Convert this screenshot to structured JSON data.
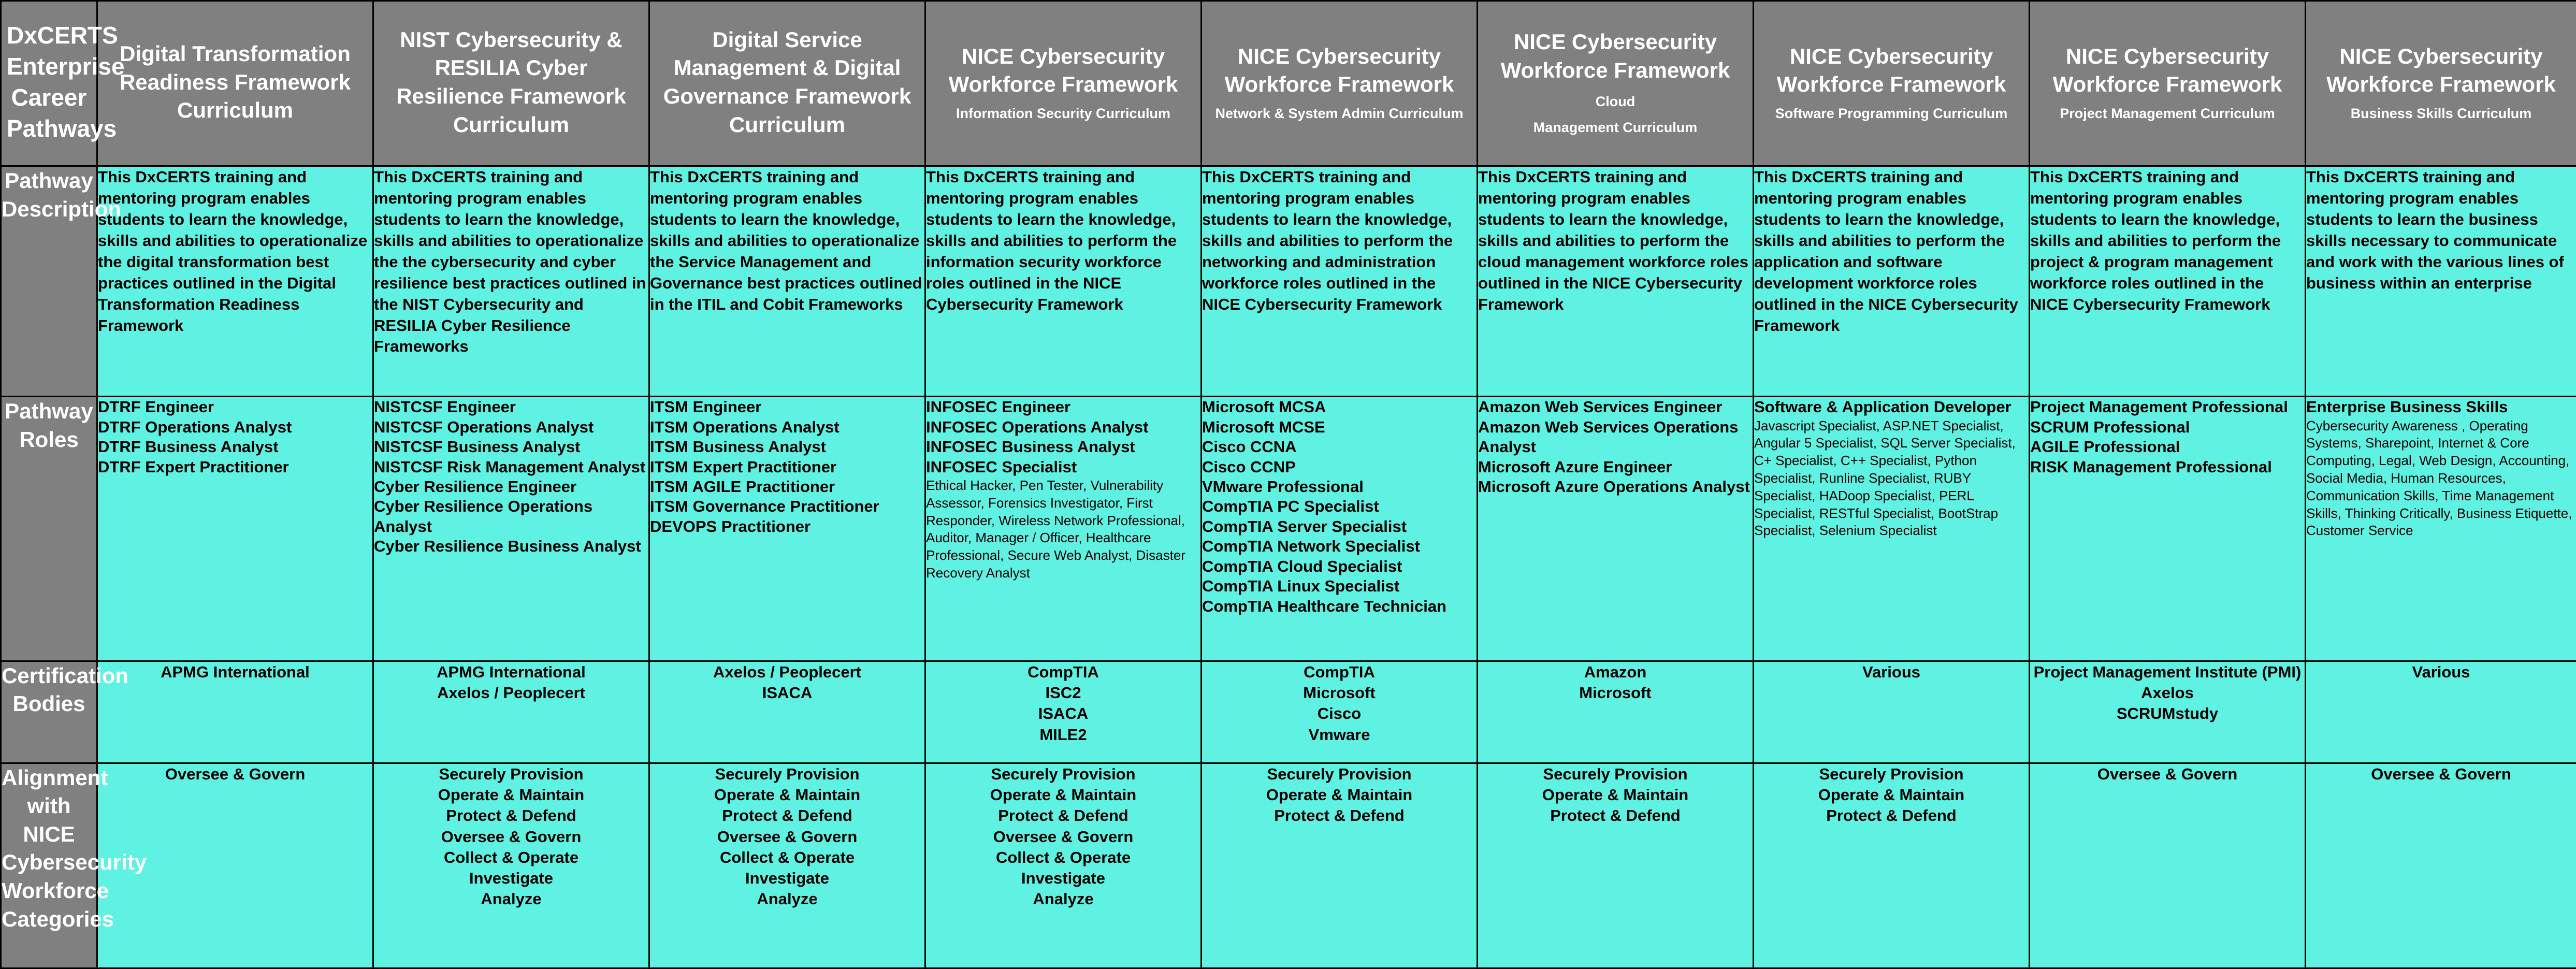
{
  "table": {
    "corner_title": "DxCERTS Enterprise Career Pathways",
    "columns": [
      {
        "title": "Digital Transformation Readiness Framework Curriculum",
        "subtitle": "",
        "inline_suffix": ""
      },
      {
        "title": "NIST Cybersecurity & RESILIA Cyber Resilience Framework Curriculum",
        "subtitle": "",
        "inline_suffix": ""
      },
      {
        "title": "Digital Service Management & Digital Governance Framework Curriculum",
        "subtitle": "",
        "inline_suffix": ""
      },
      {
        "title": "NICE Cybersecurity Workforce Framework",
        "subtitle": "Information Security Curriculum",
        "inline_suffix": ""
      },
      {
        "title": "NICE Cybersecurity Workforce Framework",
        "subtitle": "Network & System Admin Curriculum",
        "inline_suffix": ""
      },
      {
        "title": "NICE Cybersecurity Workforce Framework",
        "subtitle": "Management Curriculum",
        "inline_suffix": "Cloud"
      },
      {
        "title": "NICE Cybersecurity Workforce Framework",
        "subtitle": "Software Programming Curriculum",
        "inline_suffix": ""
      },
      {
        "title": "NICE Cybersecurity Workforce Framework",
        "subtitle": "Project Management Curriculum",
        "inline_suffix": ""
      },
      {
        "title": "NICE Cybersecurity Workforce Framework",
        "subtitle": "Business Skills Curriculum",
        "inline_suffix": ""
      }
    ],
    "rows": {
      "pathway_description": {
        "label": "Pathway Description",
        "cells": [
          "This DxCERTS training and mentoring program enables students to learn the knowledge, skills and abilities to operationalize the digital transformation best practices outlined in the Digital Transformation Readiness Framework",
          "This DxCERTS training and mentoring program enables students to learn the knowledge, skills and abilities to operationalize the the cybersecurity and cyber resilience best practices outlined in the NIST Cybersecurity and RESILIA Cyber Resilience Frameworks",
          "This DxCERTS training and mentoring program enables students to learn the knowledge, skills and abilities to operationalize the Service Management and Governance best practices outlined in the ITIL and Cobit Frameworks",
          "This DxCERTS training and mentoring program enables students to learn the knowledge, skills and abilities to perform the information security workforce roles outlined in the NICE Cybersecurity Framework",
          "This DxCERTS training and mentoring program enables students to learn the knowledge, skills and abilities to perform the networking and administration workforce roles  outlined in the NICE Cybersecurity Framework",
          "This DxCERTS training and mentoring program enables students to learn the knowledge, skills and abilities to perform the cloud management workforce roles outlined in the NICE Cybersecurity Framework",
          "This DxCERTS training and mentoring program enables students to learn the knowledge, skills and abilities to perform the application and software development workforce roles outlined in the NICE Cybersecurity Framework",
          "This DxCERTS training and mentoring program enables students to learn the knowledge, skills and abilities to perform the project & program management workforce roles outlined in the NICE Cybersecurity Framework",
          "This DxCERTS training and mentoring program enables students to learn the business skills necessary to communicate and work with the various lines of business within an enterprise"
        ]
      },
      "pathway_roles": {
        "label": "Pathway Roles",
        "cells": [
          {
            "bold_roles": [
              "DTRF Engineer",
              "DTRF Operations Analyst",
              "DTRF Business Analyst",
              "DTRF Expert Practitioner"
            ],
            "extra": ""
          },
          {
            "bold_roles": [
              "NISTCSF Engineer",
              "NISTCSF Operations Analyst",
              "NISTCSF Business Analyst",
              "NISTCSF Risk Management Analyst",
              "Cyber Resilience Engineer",
              "Cyber Resilience Operations Analyst",
              "Cyber Resilience Business Analyst"
            ],
            "extra": ""
          },
          {
            "bold_roles": [
              "ITSM Engineer",
              "ITSM Operations Analyst",
              "ITSM Business Analyst",
              "ITSM Expert Practitioner",
              "ITSM AGILE Practitioner",
              "ITSM Governance Practitioner",
              "DEVOPS Practitioner"
            ],
            "extra": ""
          },
          {
            "bold_roles": [
              "INFOSEC Engineer",
              "INFOSEC Operations Analyst",
              "INFOSEC Business Analyst",
              "INFOSEC Specialist"
            ],
            "extra": "Ethical Hacker, Pen Tester, Vulnerability Assessor, Forensics Investigator, First Responder, Wireless Network Professional, Auditor, Manager / Officer, Healthcare Professional, Secure Web Analyst, Disaster Recovery Analyst"
          },
          {
            "bold_roles": [
              "Microsoft MCSA",
              "Microsoft MCSE",
              "Cisco CCNA",
              "Cisco CCNP",
              "VMware Professional",
              "CompTIA PC Specialist",
              "CompTIA Server Specialist",
              "CompTIA Network Specialist",
              "CompTIA Cloud Specialist",
              "CompTIA Linux Specialist",
              "CompTIA Healthcare Technician"
            ],
            "extra": ""
          },
          {
            "bold_roles": [
              "Amazon Web Services Engineer",
              "Amazon Web Services Operations Analyst",
              "Microsoft Azure Engineer",
              "Microsoft Azure Operations Analyst"
            ],
            "extra": ""
          },
          {
            "bold_roles": [
              "Software & Application Developer"
            ],
            "extra": "Javascript Specialist, ASP.NET Specialist, Angular 5 Specialist, SQL Server Specialist, C+ Specialist, C++ Specialist, Python Specialist, Runline Specialist, RUBY Specialist, HADoop Specialist, PERL Specialist, RESTful Specialist, BootStrap Specialist, Selenium Specialist"
          },
          {
            "bold_roles": [
              "Project Management Professional",
              "SCRUM Professional",
              "AGILE Professional",
              "RISK Management Professional"
            ],
            "extra": ""
          },
          {
            "bold_roles": [
              "Enterprise Business Skills"
            ],
            "extra": "Cybersecurity Awareness , Operating Systems, Sharepoint, Internet & Core Computing, Legal, Web Design, Accounting, Social Media, Human Resources, Communication Skills, Time Management Skills, Thinking Critically, Business Etiquette, Customer Service"
          }
        ]
      },
      "certification_bodies": {
        "label": "Certification Bodies",
        "cells": [
          [
            "APMG International"
          ],
          [
            "APMG International",
            "Axelos / Peoplecert"
          ],
          [
            "Axelos / Peoplecert",
            "ISACA"
          ],
          [
            "CompTIA",
            "ISC2",
            "ISACA",
            "MILE2"
          ],
          [
            "CompTIA",
            "Microsoft",
            "Cisco",
            "Vmware"
          ],
          [
            "Amazon",
            "Microsoft"
          ],
          [
            "Various"
          ],
          [
            "Project Management Institute (PMI)",
            "Axelos",
            "SCRUMstudy"
          ],
          [
            "Various"
          ]
        ]
      },
      "alignment": {
        "label": "Alignment with NICE Cybersecurity Workforce Categories",
        "cells": [
          [
            "Oversee & Govern"
          ],
          [
            "Securely Provision",
            "Operate & Maintain",
            "Protect & Defend",
            "Oversee & Govern",
            "Collect & Operate",
            "Investigate",
            "Analyze"
          ],
          [
            "Securely Provision",
            "Operate & Maintain",
            "Protect & Defend",
            "Oversee & Govern",
            "Collect & Operate",
            "Investigate",
            "Analyze"
          ],
          [
            "Securely Provision",
            "Operate & Maintain",
            "Protect & Defend",
            "Oversee & Govern",
            "Collect & Operate",
            "Investigate",
            "Analyze"
          ],
          [
            "Securely Provision",
            "Operate & Maintain",
            "Protect & Defend"
          ],
          [
            "Securely Provision",
            "Operate & Maintain",
            "Protect & Defend"
          ],
          [
            "Securely Provision",
            "Operate & Maintain",
            "Protect & Defend"
          ],
          [
            "Oversee & Govern"
          ],
          [
            "Oversee & Govern"
          ]
        ]
      }
    }
  },
  "colors": {
    "header_bg": "#808080",
    "header_text": "#FFFFFF",
    "cell_bg": "#5FF2E2",
    "cell_text": "#000000",
    "grid": "#000000"
  }
}
